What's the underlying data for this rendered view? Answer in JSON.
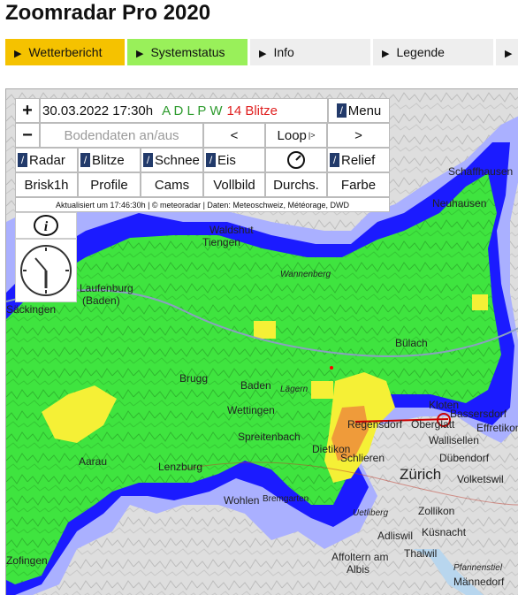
{
  "app": {
    "title": "Zoomradar Pro 2020"
  },
  "tabs": [
    {
      "label": "Wetterbericht",
      "bg": "#f5c200"
    },
    {
      "label": "Systemstatus",
      "bg": "#99f05a"
    },
    {
      "label": "Info",
      "bg": "#eeeeee"
    },
    {
      "label": "Legende",
      "bg": "#eeeeee"
    },
    {
      "label": "",
      "bg": "#eeeeee"
    }
  ],
  "controls": {
    "zoom_in": "+",
    "zoom_out": "−",
    "datetime": "30.03.2022 17:30h",
    "status_letters": "A D L P W",
    "lightning_count": "14 Blitze",
    "menu": "Menu",
    "ground_data": "Bodendaten an/aus",
    "prev": "<",
    "loop": "Loop",
    "loop_icon": "|>",
    "next": ">",
    "radar": "Radar",
    "blitze": "Blitze",
    "schnee": "Schnee",
    "eis": "Eis",
    "relief": "Relief",
    "brisk": "Brisk1h",
    "profile": "Profile",
    "cams": "Cams",
    "vollbild": "Vollbild",
    "durchs": "Durchs.",
    "farbe": "Farbe",
    "updated": "Aktualisiert um 17:46:30h | © meteoradar | Daten: Meteoschweiz, Météorage, DWD",
    "info_icon": "i",
    "check_mark": "/"
  },
  "colors": {
    "green": "#3fe43f",
    "blue": "#1b1bff",
    "yellow": "#f5f036",
    "orange": "#ef9b3a",
    "light_blue": "#aab0ff"
  },
  "icons": [
    "speedometer-icon",
    "info-icon",
    "clock-icon",
    "lightning-marker-icon"
  ],
  "places": [
    {
      "name": "Schaffhausen"
    },
    {
      "name": "Neuhausen"
    },
    {
      "name": "Waldshut"
    },
    {
      "name": "Tiengen"
    },
    {
      "name": "Wannenberg"
    },
    {
      "name": "Laufenburg"
    },
    {
      "name": "(Baden)"
    },
    {
      "name": "Säckingen"
    },
    {
      "name": "Bülach"
    },
    {
      "name": "Brugg"
    },
    {
      "name": "Baden"
    },
    {
      "name": "Lägern"
    },
    {
      "name": "Wettingen"
    },
    {
      "name": "Kloten"
    },
    {
      "name": "Bassersdorf"
    },
    {
      "name": "Effretikon"
    },
    {
      "name": "Regensdorf"
    },
    {
      "name": "Oberglatt"
    },
    {
      "name": "Wallisellen"
    },
    {
      "name": "Spreitenbach"
    },
    {
      "name": "Dübendorf"
    },
    {
      "name": "Aarau"
    },
    {
      "name": "Dietikon"
    },
    {
      "name": "Schlieren"
    },
    {
      "name": "Lenzburg"
    },
    {
      "name": "Zürich"
    },
    {
      "name": "Volketswil"
    },
    {
      "name": "Wohlen"
    },
    {
      "name": "Bremgarten"
    },
    {
      "name": "Zollikon"
    },
    {
      "name": "Uetliberg"
    },
    {
      "name": "Küsnacht"
    },
    {
      "name": "Adliswil"
    },
    {
      "name": "Zofingen"
    },
    {
      "name": "Thalwil"
    },
    {
      "name": "Affoltern am"
    },
    {
      "name": "Albis"
    },
    {
      "name": "Männedorf"
    },
    {
      "name": "Pfannenstiel"
    }
  ]
}
